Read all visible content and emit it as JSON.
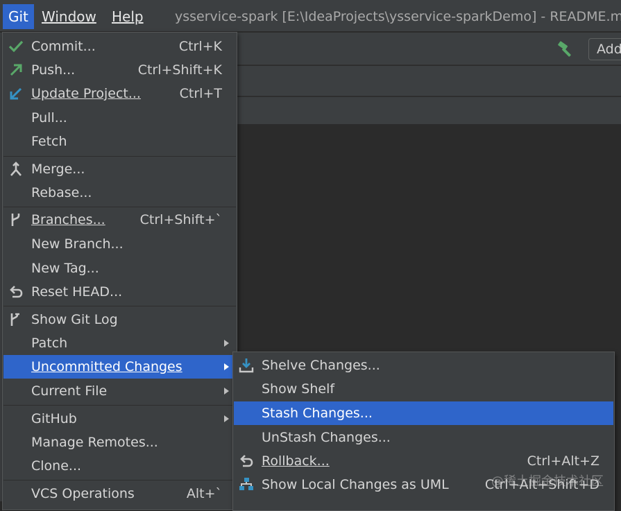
{
  "menubar": {
    "git": "Git",
    "window": "Window",
    "help": "Help",
    "title": "ysservice-spark [E:\\IdeaProjects\\ysservice-sparkDemo] - README.m"
  },
  "toolbar": {
    "add_config_label": "Add",
    "hammer_icon": "hammer-icon"
  },
  "git_menu": {
    "items": [
      {
        "label": "Commit...",
        "shortcut": "Ctrl+K",
        "icon": "check-icon"
      },
      {
        "label": "Push...",
        "shortcut": "Ctrl+Shift+K",
        "icon": "push-arrow-icon"
      },
      {
        "label": "Update Project...",
        "shortcut": "Ctrl+T",
        "icon": "update-arrow-icon"
      },
      {
        "label": "Pull...",
        "shortcut": ""
      },
      {
        "label": "Fetch",
        "shortcut": ""
      },
      {
        "label": "Merge...",
        "shortcut": "",
        "icon": "merge-icon"
      },
      {
        "label": "Rebase...",
        "shortcut": ""
      },
      {
        "label": "Branches...",
        "shortcut": "Ctrl+Shift+`",
        "icon": "branch-icon"
      },
      {
        "label": "New Branch...",
        "shortcut": ""
      },
      {
        "label": "New Tag...",
        "shortcut": ""
      },
      {
        "label": "Reset HEAD...",
        "shortcut": "",
        "icon": "reset-icon"
      },
      {
        "label": "Show Git Log",
        "shortcut": "",
        "icon": "git-log-icon"
      },
      {
        "label": "Patch",
        "shortcut": ""
      },
      {
        "label": "Uncommitted Changes",
        "shortcut": ""
      },
      {
        "label": "Current File",
        "shortcut": ""
      },
      {
        "label": "GitHub",
        "shortcut": ""
      },
      {
        "label": "Manage Remotes...",
        "shortcut": ""
      },
      {
        "label": "Clone...",
        "shortcut": ""
      },
      {
        "label": "VCS Operations",
        "shortcut": "Alt+`"
      }
    ]
  },
  "sub_menu": {
    "items": [
      {
        "label": "Shelve Changes...",
        "shortcut": "",
        "icon": "shelve-icon"
      },
      {
        "label": "Show Shelf",
        "shortcut": ""
      },
      {
        "label": "Stash Changes...",
        "shortcut": ""
      },
      {
        "label": "UnStash Changes...",
        "shortcut": ""
      },
      {
        "label": "Rollback...",
        "shortcut": "Ctrl+Alt+Z",
        "icon": "rollback-icon"
      },
      {
        "label": "Show Local Changes as UML",
        "shortcut": "Ctrl+Alt+Shift+D",
        "icon": "uml-icon"
      }
    ]
  },
  "watermark": "@稀土掘金技术社区",
  "colors": {
    "selection": "#2f65ca",
    "menu_bg": "#3c3f41",
    "check_green": "#59a869",
    "arrow_blue": "#3592c4"
  }
}
